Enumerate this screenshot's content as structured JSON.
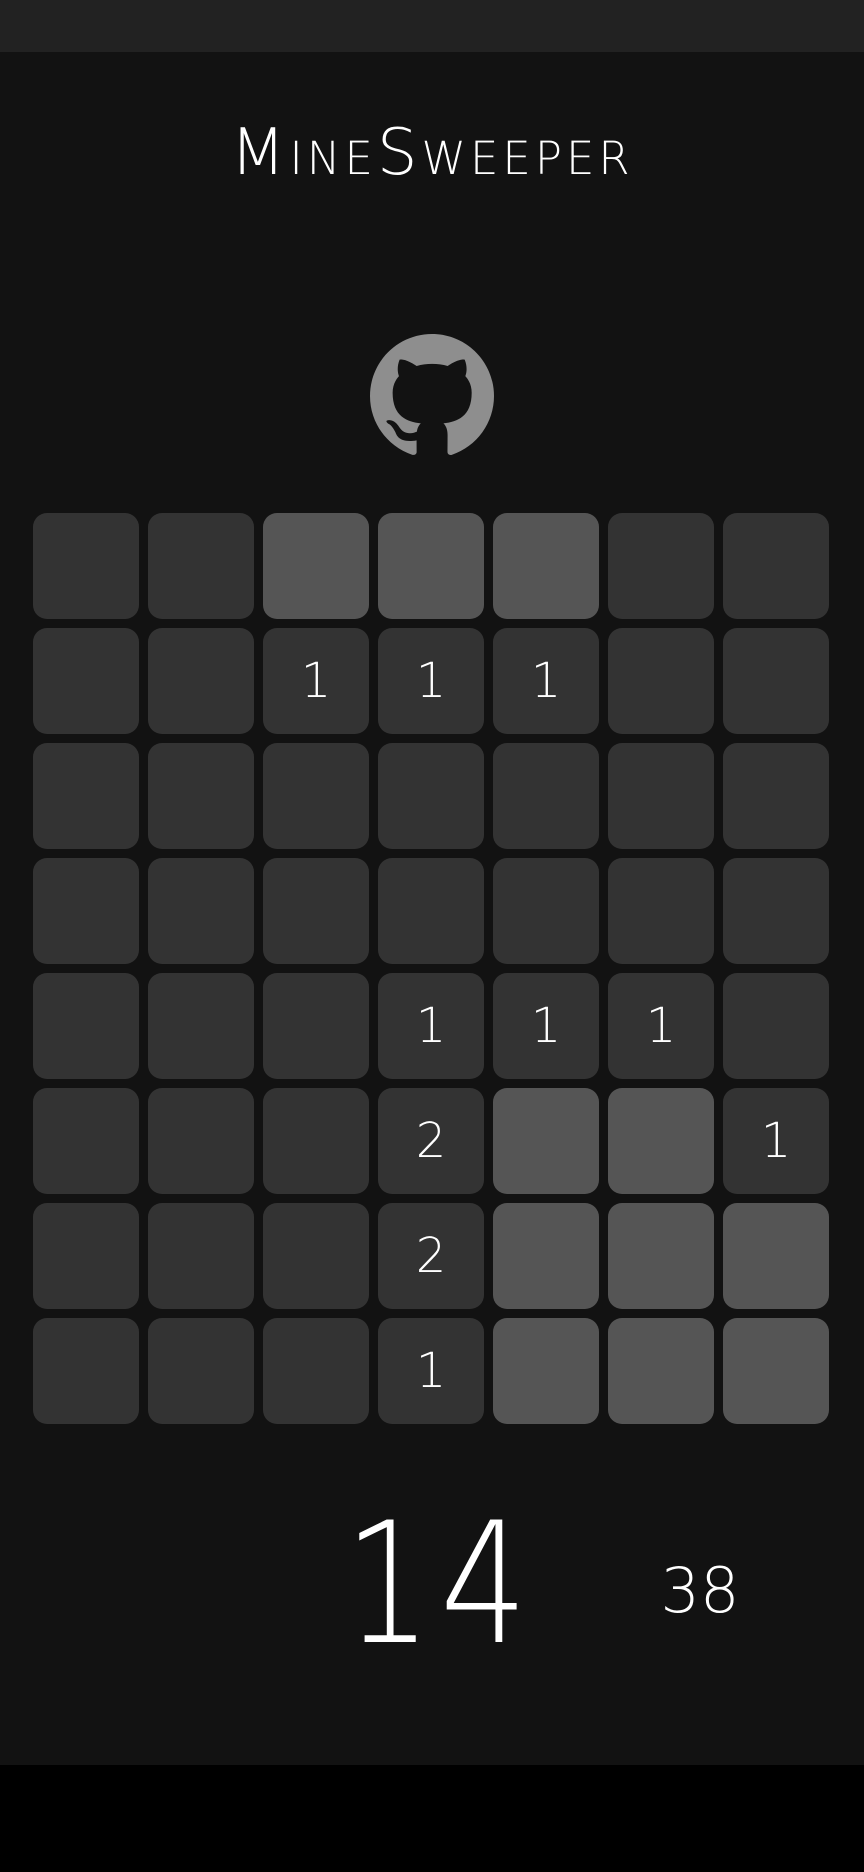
{
  "app": {
    "title": "MineSweeper",
    "github_icon": "github-octocat-icon"
  },
  "board": {
    "rows": 8,
    "cols": 7,
    "colors": {
      "revealed": "#333333",
      "hidden": "#555555",
      "text": "#ffffff"
    },
    "cells": [
      [
        {
          "state": "revealed",
          "value": ""
        },
        {
          "state": "revealed",
          "value": ""
        },
        {
          "state": "hidden",
          "value": ""
        },
        {
          "state": "hidden",
          "value": ""
        },
        {
          "state": "hidden",
          "value": ""
        },
        {
          "state": "revealed",
          "value": ""
        },
        {
          "state": "revealed",
          "value": ""
        }
      ],
      [
        {
          "state": "revealed",
          "value": ""
        },
        {
          "state": "revealed",
          "value": ""
        },
        {
          "state": "revealed",
          "value": "1"
        },
        {
          "state": "revealed",
          "value": "1"
        },
        {
          "state": "revealed",
          "value": "1"
        },
        {
          "state": "revealed",
          "value": ""
        },
        {
          "state": "revealed",
          "value": ""
        }
      ],
      [
        {
          "state": "revealed",
          "value": ""
        },
        {
          "state": "revealed",
          "value": ""
        },
        {
          "state": "revealed",
          "value": ""
        },
        {
          "state": "revealed",
          "value": ""
        },
        {
          "state": "revealed",
          "value": ""
        },
        {
          "state": "revealed",
          "value": ""
        },
        {
          "state": "revealed",
          "value": ""
        }
      ],
      [
        {
          "state": "revealed",
          "value": ""
        },
        {
          "state": "revealed",
          "value": ""
        },
        {
          "state": "revealed",
          "value": ""
        },
        {
          "state": "revealed",
          "value": ""
        },
        {
          "state": "revealed",
          "value": ""
        },
        {
          "state": "revealed",
          "value": ""
        },
        {
          "state": "revealed",
          "value": ""
        }
      ],
      [
        {
          "state": "revealed",
          "value": ""
        },
        {
          "state": "revealed",
          "value": ""
        },
        {
          "state": "revealed",
          "value": ""
        },
        {
          "state": "revealed",
          "value": "1"
        },
        {
          "state": "revealed",
          "value": "1"
        },
        {
          "state": "revealed",
          "value": "1"
        },
        {
          "state": "revealed",
          "value": ""
        }
      ],
      [
        {
          "state": "revealed",
          "value": ""
        },
        {
          "state": "revealed",
          "value": ""
        },
        {
          "state": "revealed",
          "value": ""
        },
        {
          "state": "revealed",
          "value": "2"
        },
        {
          "state": "hidden",
          "value": ""
        },
        {
          "state": "hidden",
          "value": ""
        },
        {
          "state": "revealed",
          "value": "1"
        }
      ],
      [
        {
          "state": "revealed",
          "value": ""
        },
        {
          "state": "revealed",
          "value": ""
        },
        {
          "state": "revealed",
          "value": ""
        },
        {
          "state": "revealed",
          "value": "2"
        },
        {
          "state": "hidden",
          "value": ""
        },
        {
          "state": "hidden",
          "value": ""
        },
        {
          "state": "hidden",
          "value": ""
        }
      ],
      [
        {
          "state": "revealed",
          "value": ""
        },
        {
          "state": "revealed",
          "value": ""
        },
        {
          "state": "revealed",
          "value": ""
        },
        {
          "state": "revealed",
          "value": "1"
        },
        {
          "state": "hidden",
          "value": ""
        },
        {
          "state": "hidden",
          "value": ""
        },
        {
          "state": "hidden",
          "value": ""
        }
      ]
    ]
  },
  "counters": {
    "main": "14",
    "side": "38"
  }
}
